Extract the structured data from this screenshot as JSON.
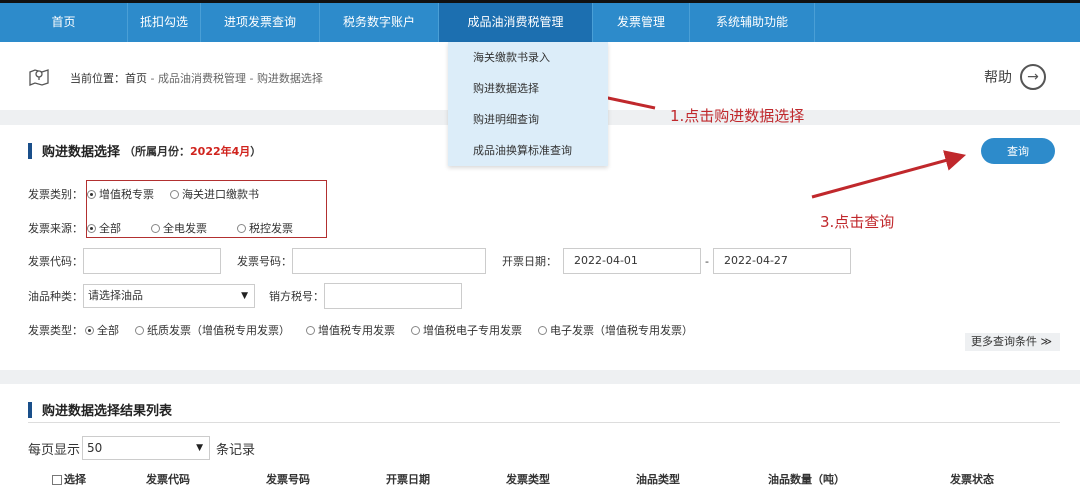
{
  "nav": {
    "items": [
      "首页",
      "抵扣勾选",
      "进项发票查询",
      "税务数字账户",
      "成品油消费税管理",
      "发票管理",
      "系统辅助功能"
    ],
    "active_index": 4
  },
  "dropdown": {
    "items": [
      "海关缴款书录入",
      "购进数据选择",
      "购进明细查询",
      "成品油换算标准查询"
    ]
  },
  "breadcrumb": {
    "prefix": "当前位置：首页",
    "sep1": " - ",
    "part2": "成品油消费税管理",
    "sep2": " - ",
    "part3": "购进数据选择"
  },
  "help": {
    "label": "帮助",
    "icon": "arrow-right-circle-icon"
  },
  "query_section": {
    "title": "购进数据选择",
    "month_prefix": "（所属月份：",
    "month_value": "2022年4月",
    "month_suffix": "）",
    "query_button": "查询"
  },
  "filters": {
    "invoice_category": {
      "label": "发票类别：",
      "options": [
        "增值税专票",
        "海关进口缴款书"
      ],
      "selected": 0
    },
    "invoice_source": {
      "label": "发票来源：",
      "options": [
        "全部",
        "全电发票",
        "税控发票"
      ],
      "selected": 0
    },
    "invoice_code": {
      "label": "发票代码：",
      "value": ""
    },
    "invoice_number": {
      "label": "发票号码：",
      "value": ""
    },
    "issue_date": {
      "label": "开票日期：",
      "from": "2022-04-01",
      "sep": "-",
      "to": "2022-04-27"
    },
    "oil_type": {
      "label": "油品种类：",
      "value": "请选择油品"
    },
    "seller_tax_id": {
      "label": "销方税号：",
      "value": ""
    },
    "invoice_type": {
      "label": "发票类型：",
      "options": [
        "全部",
        "纸质发票（增值税专用发票）",
        "增值税专用发票",
        "增值税电子专用发票",
        "电子发票（增值税专用发票）"
      ],
      "selected": 0
    },
    "more_conditions": "更多查询条件 ≫"
  },
  "results": {
    "title": "购进数据选择结果列表",
    "per_page_label": "每页显示",
    "per_page_value": "50",
    "per_page_suffix": "条记录",
    "columns": [
      "选择",
      "发票代码",
      "发票号码",
      "开票日期",
      "发票类型",
      "油品类型",
      "油品数量（吨）",
      "发票状态"
    ]
  },
  "annotations": {
    "step1": "1.点击购进数据选择",
    "step3": "3.点击查询",
    "color": "#c0282c"
  }
}
